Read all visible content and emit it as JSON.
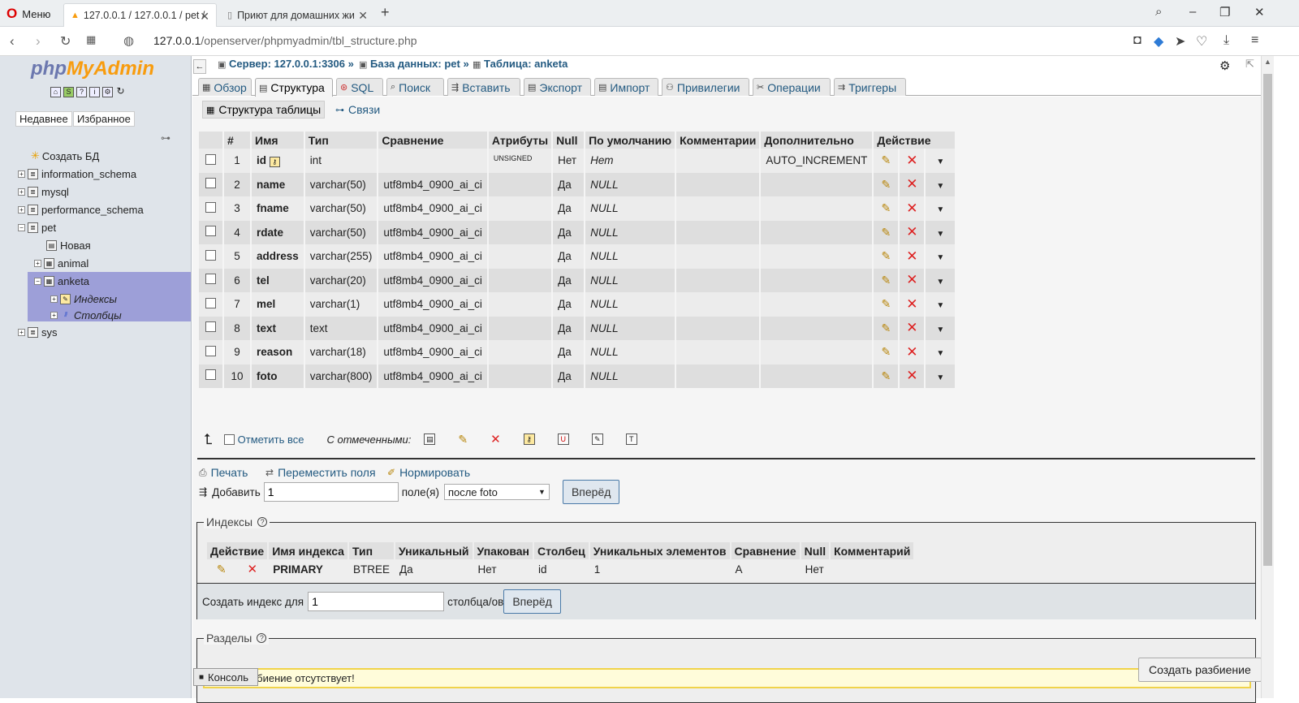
{
  "browser": {
    "menu_label": "Меню",
    "tabs": [
      {
        "title": "127.0.0.1 / 127.0.0.1 / pet /"
      },
      {
        "title": "Приют для домашних жи"
      }
    ],
    "url_host": "127.0.0.1",
    "url_path": "/openserver/phpmyadmin/tbl_structure.php"
  },
  "sidebar": {
    "logo_a": "php",
    "logo_b": "MyAdmin",
    "recent_label": "Недавнее",
    "favorites_label": "Избранное",
    "tree": [
      {
        "label": "Создать БД"
      },
      {
        "label": "information_schema"
      },
      {
        "label": "mysql"
      },
      {
        "label": "performance_schema"
      },
      {
        "label": "pet"
      },
      {
        "label": "Новая"
      },
      {
        "label": "animal"
      },
      {
        "label": "anketa"
      },
      {
        "label": "Индексы"
      },
      {
        "label": "Столбцы"
      },
      {
        "label": "sys"
      }
    ]
  },
  "breadcrumb": {
    "server": "Сервер: 127.0.0.1:3306",
    "database": "База данных: pet",
    "table": "Таблица: anketa"
  },
  "tabs": [
    "Обзор",
    "Структура",
    "SQL",
    "Поиск",
    "Вставить",
    "Экспорт",
    "Импорт",
    "Привилегии",
    "Операции",
    "Триггеры"
  ],
  "subtabs": [
    "Структура таблицы",
    "Связи"
  ],
  "structure": {
    "headers": [
      "",
      "#",
      "Имя",
      "Тип",
      "Сравнение",
      "Атрибуты",
      "Null",
      "По умолчанию",
      "Комментарии",
      "Дополнительно",
      "Действие"
    ],
    "rows": [
      {
        "n": "1",
        "name": "id",
        "type": "int",
        "collation": "",
        "attr": "UNSIGNED",
        "null": "Нет",
        "default": "Нет",
        "extra": "AUTO_INCREMENT"
      },
      {
        "n": "2",
        "name": "name",
        "type": "varchar(50)",
        "collation": "utf8mb4_0900_ai_ci",
        "attr": "",
        "null": "Да",
        "default": "NULL",
        "extra": ""
      },
      {
        "n": "3",
        "name": "fname",
        "type": "varchar(50)",
        "collation": "utf8mb4_0900_ai_ci",
        "attr": "",
        "null": "Да",
        "default": "NULL",
        "extra": ""
      },
      {
        "n": "4",
        "name": "rdate",
        "type": "varchar(50)",
        "collation": "utf8mb4_0900_ai_ci",
        "attr": "",
        "null": "Да",
        "default": "NULL",
        "extra": ""
      },
      {
        "n": "5",
        "name": "address",
        "type": "varchar(255)",
        "collation": "utf8mb4_0900_ai_ci",
        "attr": "",
        "null": "Да",
        "default": "NULL",
        "extra": ""
      },
      {
        "n": "6",
        "name": "tel",
        "type": "varchar(20)",
        "collation": "utf8mb4_0900_ai_ci",
        "attr": "",
        "null": "Да",
        "default": "NULL",
        "extra": ""
      },
      {
        "n": "7",
        "name": "mel",
        "type": "varchar(1)",
        "collation": "utf8mb4_0900_ai_ci",
        "attr": "",
        "null": "Да",
        "default": "NULL",
        "extra": ""
      },
      {
        "n": "8",
        "name": "text",
        "type": "text",
        "collation": "utf8mb4_0900_ai_ci",
        "attr": "",
        "null": "Да",
        "default": "NULL",
        "extra": ""
      },
      {
        "n": "9",
        "name": "reason",
        "type": "varchar(18)",
        "collation": "utf8mb4_0900_ai_ci",
        "attr": "",
        "null": "Да",
        "default": "NULL",
        "extra": ""
      },
      {
        "n": "10",
        "name": "foto",
        "type": "varchar(800)",
        "collation": "utf8mb4_0900_ai_ci",
        "attr": "",
        "null": "Да",
        "default": "NULL",
        "extra": ""
      }
    ]
  },
  "bulk": {
    "check_all": "Отметить все",
    "with_selected": "С отмеченными:"
  },
  "links": {
    "print": "Печать",
    "move": "Переместить поля",
    "normalize": "Нормировать"
  },
  "add_fields": {
    "label": "Добавить",
    "count": "1",
    "unit": "поле(я)",
    "position": "после foto",
    "go": "Вперёд"
  },
  "indexes": {
    "legend": "Индексы",
    "headers": [
      "Действие",
      "Имя индекса",
      "Тип",
      "Уникальный",
      "Упакован",
      "Столбец",
      "Уникальных элементов",
      "Сравнение",
      "Null",
      "Комментарий"
    ],
    "row": {
      "name": "PRIMARY",
      "type": "BTREE",
      "unique": "Да",
      "packed": "Нет",
      "column": "id",
      "cardinality": "1",
      "collation": "A",
      "null": "Нет",
      "comment": ""
    },
    "create_label": "Создать индекс для",
    "create_count": "1",
    "create_unit": "столбца/ов",
    "go": "Вперёд"
  },
  "partitions": {
    "legend": "Разделы",
    "warning": "Разбиение отсутствует!",
    "create_button": "Создать разбиение"
  },
  "console_label": "Консоль"
}
